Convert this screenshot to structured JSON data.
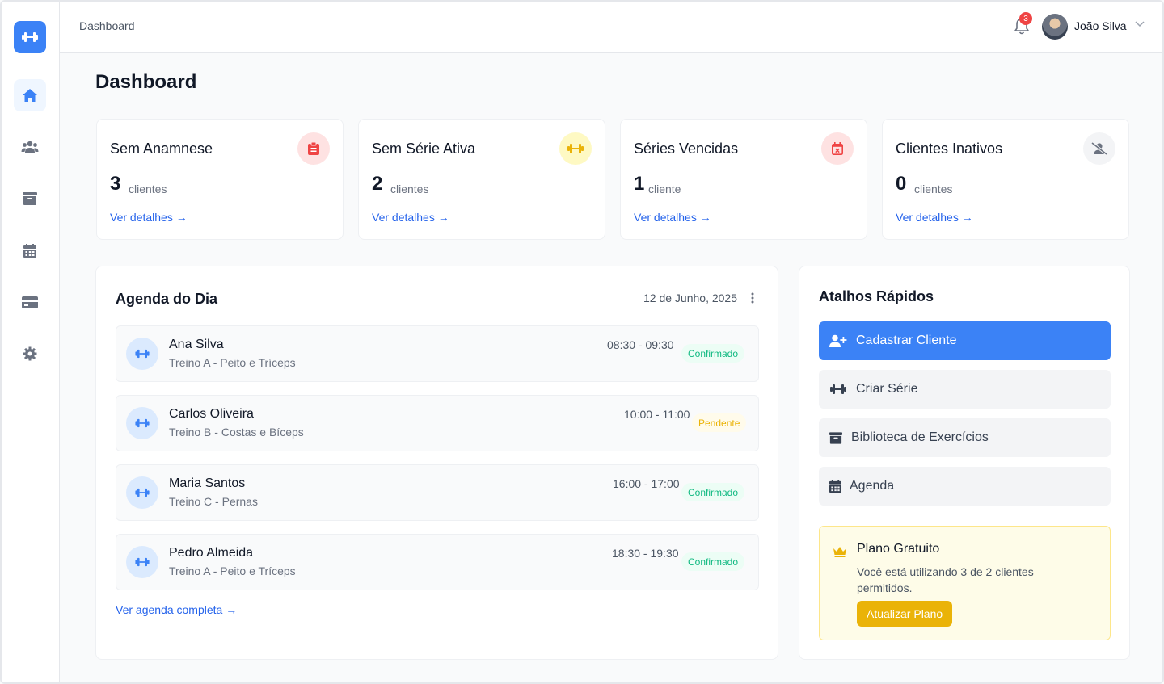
{
  "colors": {
    "primary": "#3b82f6",
    "link": "#2563eb",
    "danger": "#ef4444",
    "warning": "#eab308",
    "success": "#10b981"
  },
  "header": {
    "breadcrumb": "Dashboard",
    "notifications_count": "3",
    "user_name": "João Silva"
  },
  "sidebar": {
    "items": [
      {
        "icon": "home-icon",
        "active": true
      },
      {
        "icon": "users-icon"
      },
      {
        "icon": "archive-icon"
      },
      {
        "icon": "calendar-icon"
      },
      {
        "icon": "credit-card-icon"
      },
      {
        "icon": "gear-icon"
      }
    ]
  },
  "page_title": "Dashboard",
  "stats": [
    {
      "title": "Sem Anamnese",
      "value": "3",
      "unit": "clientes",
      "link": "Ver detalhes →",
      "icon": "clipboard-icon"
    },
    {
      "title": "Sem Série Ativa",
      "value": "2",
      "unit": "clientes",
      "link": "Ver detalhes →",
      "icon": "dumbbell-icon"
    },
    {
      "title": "Séries Vencidas",
      "value": "1",
      "unit": "cliente",
      "link": "Ver detalhes →",
      "icon": "calendar-x-icon"
    },
    {
      "title": "Clientes Inativos",
      "value": "0",
      "unit": "clientes",
      "link": "Ver detalhes →",
      "icon": "user-slash-icon"
    }
  ],
  "agenda": {
    "title": "Agenda do Dia",
    "date": "12 de Junho, 2025",
    "appointments": [
      {
        "name": "Ana Silva",
        "workout": "Treino A - Peito e Tríceps",
        "time": "08:30 - 09:30",
        "status": "Confirmado"
      },
      {
        "name": "Carlos Oliveira",
        "workout": "Treino B - Costas e Bíceps",
        "time": "10:00 - 11:00",
        "status": "Pendente"
      },
      {
        "name": "Maria Santos",
        "workout": "Treino C - Pernas",
        "time": "16:00 - 17:00",
        "status": "Confirmado"
      },
      {
        "name": "Pedro Almeida",
        "workout": "Treino A - Peito e Tríceps",
        "time": "18:30 - 19:30",
        "status": "Confirmado"
      }
    ],
    "full_link": "Ver agenda completa →"
  },
  "shortcuts": {
    "title": "Atalhos Rápidos",
    "items": [
      {
        "label": "Cadastrar Cliente",
        "icon": "user-plus-icon"
      },
      {
        "label": "Criar Série",
        "icon": "dumbbell-icon"
      },
      {
        "label": "Biblioteca de Exercícios",
        "icon": "archive-icon"
      },
      {
        "label": "Agenda",
        "icon": "calendar-icon"
      }
    ]
  },
  "plan": {
    "title": "Plano Gratuito",
    "text": "Você está utilizando 3 de 2 clientes permitidos.",
    "button": "Atualizar Plano"
  }
}
